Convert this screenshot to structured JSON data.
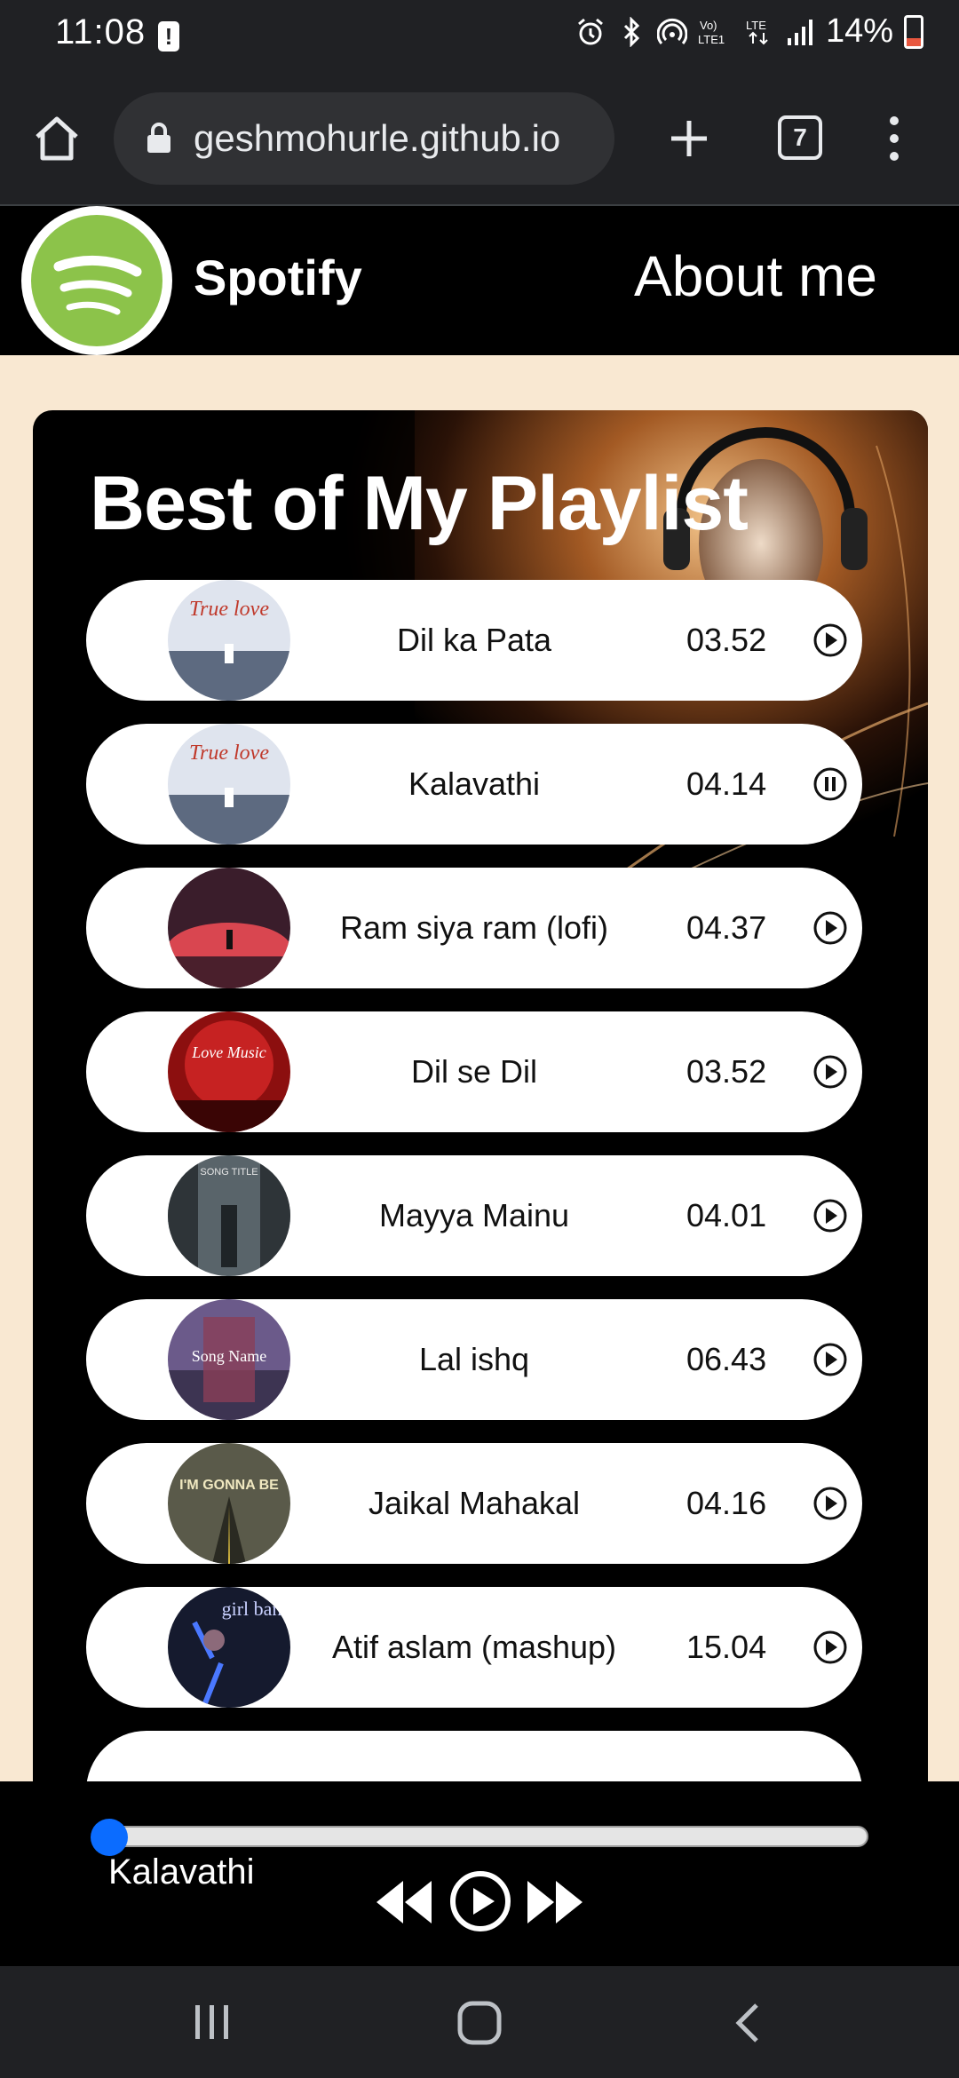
{
  "status_bar": {
    "time": "11:08",
    "alert_badge": "!",
    "battery": "14%",
    "icons": [
      "alarm-icon",
      "bluetooth-icon",
      "hotspot-icon",
      "volte-icon",
      "lte-icon",
      "signal-icon",
      "battery-icon"
    ]
  },
  "browser": {
    "url": "geshmohurle.github.io",
    "tab_count": "7"
  },
  "header": {
    "brand": "Spotify",
    "about_link": "About me",
    "logo_color": "#8cc34a"
  },
  "playlist": {
    "title": "Best of My Playlist",
    "songs": [
      {
        "name": "Dil ka Pata",
        "duration": "03.52",
        "state": "play",
        "art": "true-love"
      },
      {
        "name": "Kalavathi",
        "duration": "04.14",
        "state": "pause",
        "art": "true-love"
      },
      {
        "name": "Ram siya ram (lofi)",
        "duration": "04.37",
        "state": "play",
        "art": "red-canyon"
      },
      {
        "name": "Dil se Dil",
        "duration": "03.52",
        "state": "play",
        "art": "love-music"
      },
      {
        "name": "Mayya Mainu",
        "duration": "04.01",
        "state": "play",
        "art": "song-title"
      },
      {
        "name": "Lal ishq",
        "duration": "06.43",
        "state": "play",
        "art": "song-name"
      },
      {
        "name": "Jaikal Mahakal",
        "duration": "04.16",
        "state": "play",
        "art": "im-gonna-be"
      },
      {
        "name": "Atif aslam (mashup)",
        "duration": "15.04",
        "state": "play",
        "art": "girl-band"
      }
    ]
  },
  "album_text": {
    "true_love": "True love",
    "love_music": "Love Music",
    "song_title": "SONG TITLE",
    "song_name": "Song Name",
    "im_gonna_be": "I'M GONNA BE",
    "girl_band": "girl band"
  },
  "player": {
    "now_playing": "Kalavathi",
    "progress": 0,
    "accent": "#0b6cff"
  }
}
